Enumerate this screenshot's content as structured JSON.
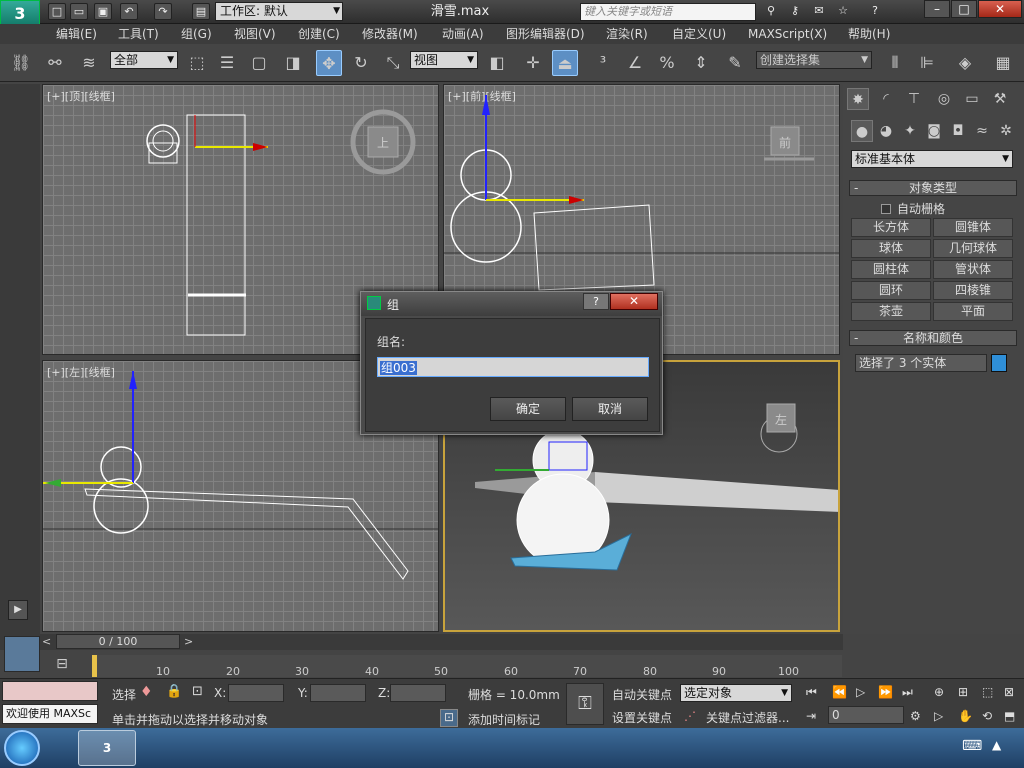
{
  "app": {
    "workspace_label": "工作区: 默认",
    "file_title": "滑雪.max",
    "search_placeholder": "键入关键字或短语"
  },
  "menu": [
    "编辑(E)",
    "工具(T)",
    "组(G)",
    "视图(V)",
    "创建(C)",
    "修改器(M)",
    "动画(A)",
    "图形编辑器(D)",
    "渲染(R)",
    "自定义(U)",
    "MAXScript(X)",
    "帮助(H)"
  ],
  "toolbar": {
    "filter_value": "全部",
    "ref_coord_value": "视图",
    "selection_set_placeholder": "创建选择集"
  },
  "viewports": {
    "top_label": "[+][顶][线框]",
    "front_label": "[+][前][线框]",
    "left_label": "[+][左][线框]",
    "top_cube": "上",
    "front_cube": "前",
    "persp_cube": "左"
  },
  "dialog": {
    "title": "组",
    "name_label": "组名:",
    "name_value": "组003",
    "ok_label": "确定",
    "cancel_label": "取消",
    "help_label": "?",
    "close_label": "✕"
  },
  "command_panel": {
    "category_value": "标准基本体",
    "object_type_header": "对象类型",
    "auto_grid_label": "自动栅格",
    "objects": [
      "长方体",
      "圆锥体",
      "球体",
      "几何球体",
      "圆柱体",
      "管状体",
      "圆环",
      "四棱锥",
      "茶壶",
      "平面"
    ],
    "name_color_header": "名称和颜色",
    "name_value": "选择了 3 个实体",
    "swatch_color": "#2f8fd8"
  },
  "timeline": {
    "slider_label": "0 / 100",
    "ticks": [
      "10",
      "20",
      "30",
      "40",
      "50",
      "60",
      "70",
      "80",
      "90",
      "100"
    ]
  },
  "status": {
    "script_line": "欢迎使用 MAXSc",
    "select_label": "选择",
    "x_label": "X:",
    "y_label": "Y:",
    "z_label": "Z:",
    "grid_label": "栅格 = 10.0mm",
    "prompt": "单击并拖动以选择并移动对象",
    "add_time_tag": "添加时间标记",
    "auto_key": "自动关键点",
    "set_key": "设置关键点",
    "selected_object": "选定对象",
    "key_filters": "关键点过滤器...",
    "frame_value": "0"
  },
  "colors": {
    "accent": "#5d8fc4",
    "persp_border": "#c8a33c",
    "close_red": "#c04030"
  }
}
